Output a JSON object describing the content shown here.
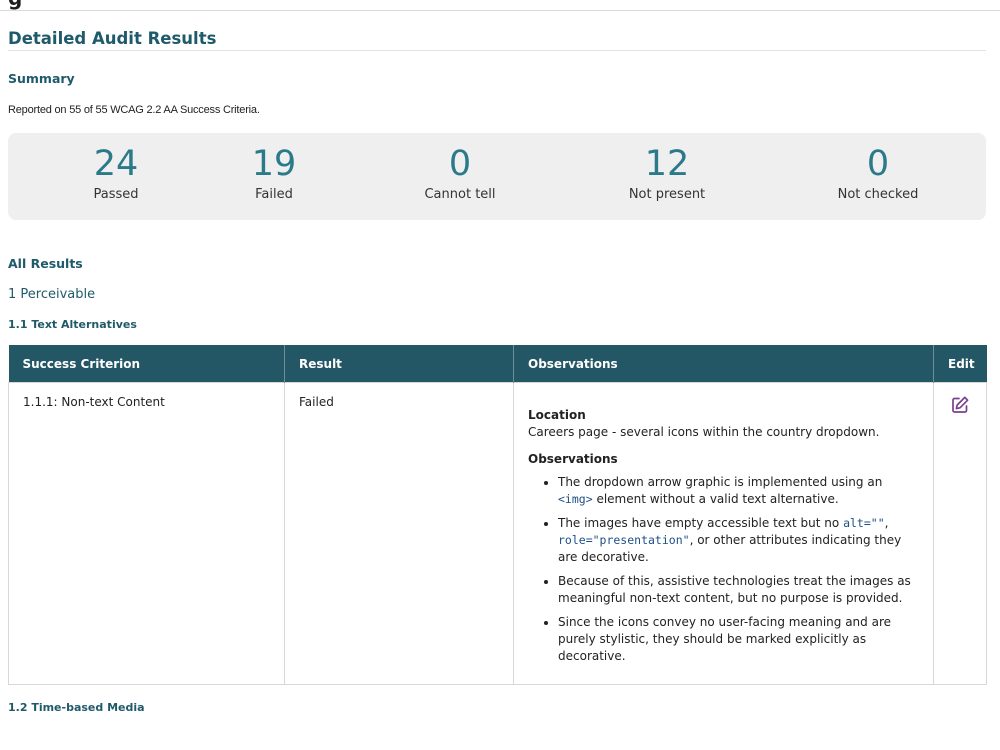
{
  "header": {
    "cut_title": "g"
  },
  "page_title": "Detailed Audit Results",
  "summary": {
    "heading": "Summary",
    "reported": "Reported on 55 of 55 WCAG 2.2 AA Success Criteria.",
    "stats": [
      {
        "value": "24",
        "label": "Passed"
      },
      {
        "value": "19",
        "label": "Failed"
      },
      {
        "value": "0",
        "label": "Cannot tell"
      },
      {
        "value": "12",
        "label": "Not present"
      },
      {
        "value": "0",
        "label": "Not checked"
      }
    ]
  },
  "all_results": {
    "heading": "All Results",
    "principle": "1 Perceivable",
    "section_1": "1.1 Text Alternatives",
    "table": {
      "headers": [
        "Success Criterion",
        "Result",
        "Observations",
        "Edit"
      ],
      "row": {
        "criterion": "1.1.1: Non-text Content",
        "result": "Failed",
        "location_heading": "Location",
        "location_text": "Careers page - several icons within the country dropdown.",
        "observations_heading": "Observations",
        "bullets": [
          {
            "parts": [
              "The dropdown arrow graphic is implemented using an ",
              "<img>",
              " element without a valid text alternative."
            ]
          },
          {
            "parts": [
              "The images have empty accessible text but no ",
              "alt=\"\"",
              ", ",
              "role=\"presentation\"",
              ", or other attributes indicating they are decorative."
            ]
          },
          {
            "parts": [
              "Because of this, assistive technologies treat the images as meaningful non-text content, but no purpose is provided."
            ]
          },
          {
            "parts": [
              "Since the icons convey no user-facing meaning and are purely stylistic, they should be marked explicitly as decorative."
            ]
          }
        ]
      }
    },
    "section_2": "1.2 Time-based Media"
  },
  "colors": {
    "accent": "#1f5a6a",
    "table_header": "#245766",
    "stat_number": "#2b7a8a",
    "edit_icon": "#7a3f8f"
  },
  "icons": {
    "edit": "edit-icon"
  }
}
